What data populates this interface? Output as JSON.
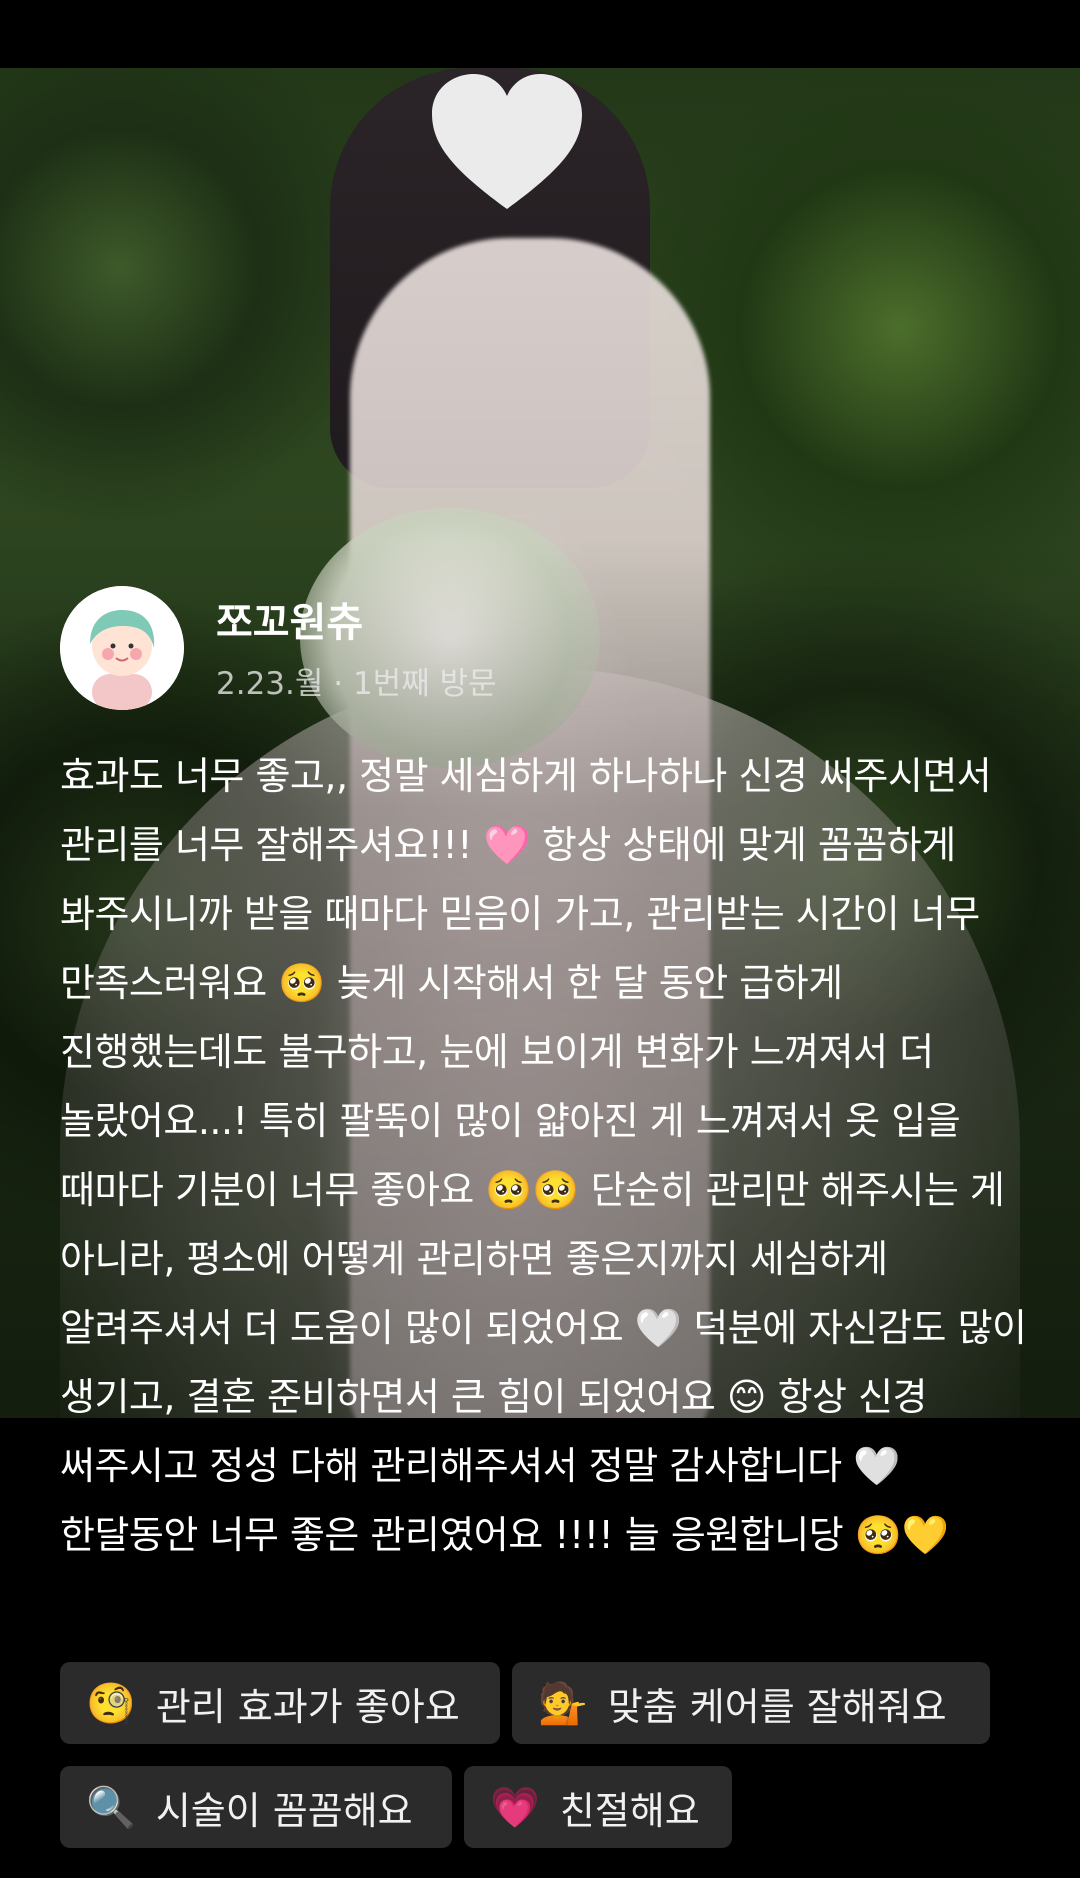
{
  "review": {
    "author": "쪼꼬원츄",
    "meta": "2.23.월 · 1번째 방문",
    "text": "효과도 너무 좋고,, 정말 세심하게 하나하나 신경 써주시면서 관리를 너무 잘해주셔요!!! 🩷 항상 상태에 맞게 꼼꼼하게 봐주시니까 받을 때마다 믿음이 가고, 관리받는 시간이 너무 만족스러워요 🥺 늦게 시작해서 한 달 동안 급하게 진행했는데도 불구하고, 눈에 보이게 변화가 느껴져서 더 놀랐어요...! 특히 팔뚝이 많이 얇아진 게 느껴져서 옷 입을 때마다 기분이 너무 좋아요 🥺🥺 단순히 관리만 해주시는 게 아니라, 평소에 어떻게 관리하면 좋은지까지 세심하게 알려주셔서 더 도움이 많이 되었어요 🤍 덕분에 자신감도 많이 생기고, 결혼 준비하면서 큰 힘이 되었어요 😊 항상 신경 써주시고 정성 다해 관리해주셔서 정말 감사합니다 🤍 한달동안 너무 좋은 관리였어요 !!!! 늘 응원합니당 🥺💛"
  },
  "tags": [
    {
      "emoji": "🧐",
      "label": "관리 효과가 좋아요"
    },
    {
      "emoji": "💁",
      "label": "맞춤 케어를 잘해줘요"
    },
    {
      "emoji": "🔍",
      "label": "시술이 꼼꼼해요"
    },
    {
      "emoji": "💗",
      "label": "친절해요"
    }
  ],
  "icons": {
    "avatar": "girl-avatar-icon",
    "face_cover": "heart-sticker-icon"
  }
}
